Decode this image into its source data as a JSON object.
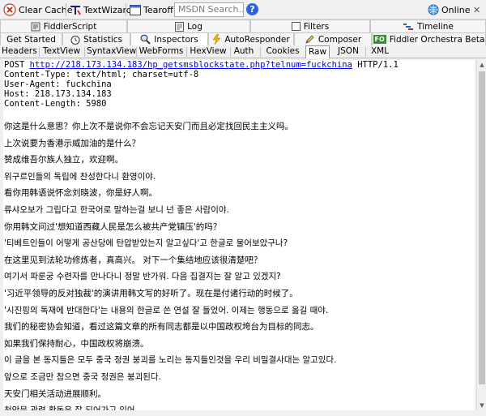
{
  "toolbar": {
    "clear_cache": "Clear Cache",
    "textwizard": "TextWizard",
    "tearoff": "Tearoff",
    "msdn_placeholder": "MSDN Search...",
    "help": "?",
    "online": "Online",
    "close": "✕"
  },
  "tabs_row1": {
    "fiddlerscript": "FiddlerScript",
    "log": "Log",
    "filters": "Filters",
    "timeline": "Timeline"
  },
  "tabs_row2": {
    "get_started": "Get Started",
    "statistics": "Statistics",
    "inspectors": "Inspectors",
    "autoresponder": "AutoResponder",
    "composer": "Composer",
    "orchestra_badge": "FO",
    "orchestra": "Fiddler Orchestra Beta"
  },
  "subtabs": [
    "Headers",
    "TextView",
    "SyntaxView",
    "WebForms",
    "HexView",
    "Auth",
    "Cookies",
    "Raw",
    "JSON",
    "XML"
  ],
  "selected_subtab": "Raw",
  "request": {
    "method": "POST",
    "url": "http://218.173.134.183/hp_getsmsblockstate.php?telnum=fuckchina",
    "protocol": " HTTP/1.1",
    "headers": [
      "Content-Type: text/html; charset=utf-8",
      "User-Agent: fuckchina",
      "Host: 218.173.134.183",
      "Content-Length: 5980"
    ]
  },
  "body_lines": [
    "你这是什么意思？你上次不是说你不会忘记天安门而且必定找回民主主义吗。",
    "上次说要为香港示威加油的是什么？",
    "赞成维吾尔族人独立，欢迎啊。",
    "위구르인들의 독립에 찬성한다니 환영이야.",
    "看你用韩语说怀念刘晓波，你是好人啊。",
    "류샤오보가 그립다고 한국어로 말하는걸 보니 넌 좋은 사람이야.",
    "你用韩文问过'想知道西藏人民是怎么被共产党镇压'的吗？",
    "'티베트인들이 어떻게 공산당에 탄압받았는지 알고싶다'고 한글로 물어보았구나?",
    "在这里见到法轮功修炼者，真高兴。 对下一个集结地应该很清楚吧？",
    "여기서 파룬궁 수련자를 만나다니 정말 반가워. 다음 집결지는 잘 알고 있겠지?",
    "'习近平领导的反对独裁'的演讲用韩文写的好听了。现在是付诸行动的时候了。",
    "'시진핑의 독재에 반대한다'는 내용의 한글로 쓴 연설 잘 들었어. 이제는 행동으로 옮길 때야.",
    "我们的秘密协会知道，看过这篇文章的所有同志都是以中国政权垮台为目标的同志。",
    "如果我们保持耐心，中国政权将崩溃。",
    "이 글을 본 동지들은 모두 중국 정권 붕괴를 노리는 동지들인것을 우리 비밀결사대는 알고있다.",
    "앞으로 조금만 참으면 중국 정권은 붕괴된다.",
    "天安门相关活动进展顺利。",
    "천안문 관련 활동은 잘 되어가고 있어"
  ],
  "scrollbar": {
    "up": "▲",
    "down": "▼"
  }
}
